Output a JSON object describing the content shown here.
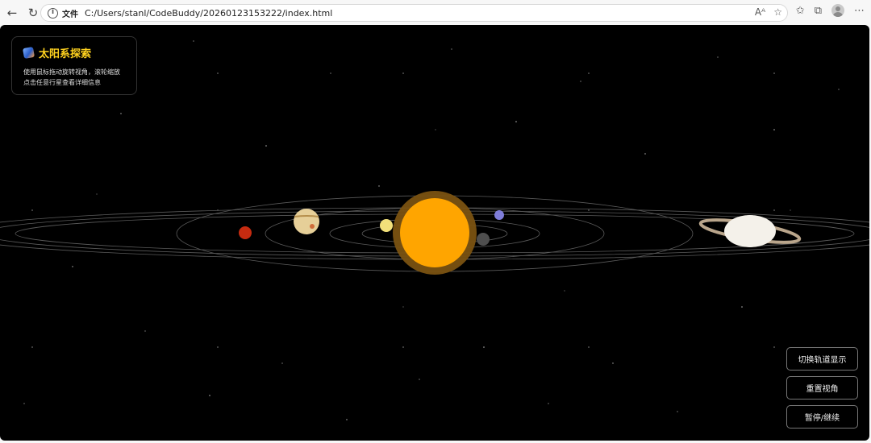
{
  "browser": {
    "file_label": "文件",
    "url": "C:/Users/stanl/CodeBuddy/20260123153222/index.html"
  },
  "panel": {
    "title": "太阳系探索",
    "line1": "使用鼠标拖动旋转视角，滚轮缩放",
    "line2": "点击任意行星查看详细信息"
  },
  "controls": {
    "toggle_orbits": "切换轨道显示",
    "reset_view": "重置视角",
    "pause_resume": "暂停/继续"
  },
  "colors": {
    "sun": "#ffa500",
    "title": "#ffd21f",
    "orbit": "#5a5a5a"
  }
}
